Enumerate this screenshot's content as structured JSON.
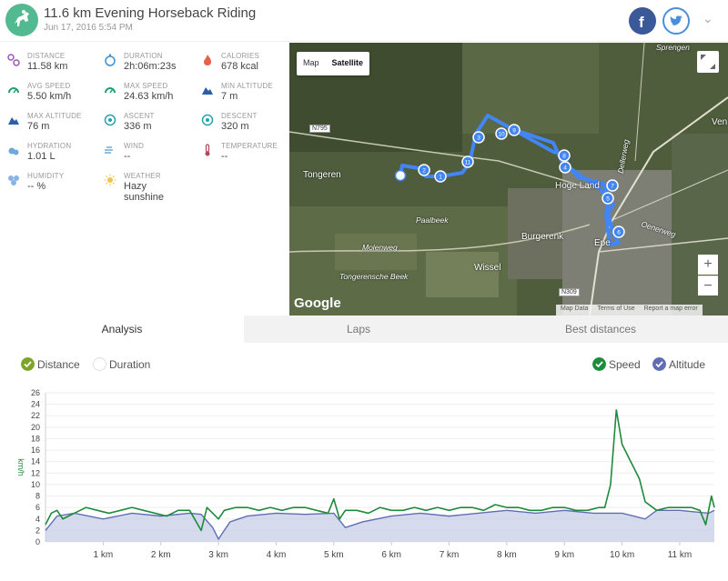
{
  "header": {
    "title": "11.6 km Evening Horseback Riding",
    "date": "Jun 17, 2016 5:54 PM"
  },
  "stats": [
    {
      "label": "DISTANCE",
      "value": "11.58 km",
      "icon": "distance-icon",
      "color": "#9b59b6"
    },
    {
      "label": "DURATION",
      "value": "2h:06m:23s",
      "icon": "stopwatch-icon",
      "color": "#3b8fd6"
    },
    {
      "label": "CALORIES",
      "value": "678 kcal",
      "icon": "flame-icon",
      "color": "#e8604c"
    },
    {
      "label": "AVG SPEED",
      "value": "5.50 km/h",
      "icon": "speedometer-icon",
      "color": "#21a07a"
    },
    {
      "label": "MAX SPEED",
      "value": "24.63 km/h",
      "icon": "speedometer-icon",
      "color": "#21a07a"
    },
    {
      "label": "MIN ALTITUDE",
      "value": "7 m",
      "icon": "mountain-icon",
      "color": "#2c5fa8"
    },
    {
      "label": "MAX ALTITUDE",
      "value": "76 m",
      "icon": "mountain-icon",
      "color": "#2c5fa8"
    },
    {
      "label": "ASCENT",
      "value": "336 m",
      "icon": "ascent-icon",
      "color": "#28a0b0"
    },
    {
      "label": "DESCENT",
      "value": "320 m",
      "icon": "descent-icon",
      "color": "#28a0b0"
    },
    {
      "label": "HYDRATION",
      "value": "1.01 L",
      "icon": "water-drops-icon",
      "color": "#6fa8dc"
    },
    {
      "label": "WIND",
      "value": "--",
      "icon": "wind-icon",
      "color": "#6fa8dc"
    },
    {
      "label": "TEMPERATURE",
      "value": "--",
      "icon": "thermometer-icon",
      "color": "#b5455b"
    },
    {
      "label": "HUMIDITY",
      "value": "-- %",
      "icon": "humidity-icon",
      "color": "#8ab4e8"
    },
    {
      "label": "WEATHER",
      "value": "Hazy sunshine",
      "icon": "weather-sun-icon",
      "color": "#f2c14e"
    }
  ],
  "map": {
    "type_map": "Map",
    "type_satellite": "Satellite",
    "zoom_in": "+",
    "zoom_out": "−",
    "logo": "Google",
    "footer": [
      "Map Data",
      "Terms of Use",
      "Report a map error"
    ],
    "labels": [
      {
        "text": "Tongeren",
        "style": ""
      },
      {
        "text": "Paalbeek",
        "style": "it"
      },
      {
        "text": "Molenweg",
        "style": "it"
      },
      {
        "text": "Wissel",
        "style": ""
      },
      {
        "text": "Burgerenk",
        "style": ""
      },
      {
        "text": "Hoge Land",
        "style": ""
      },
      {
        "text": "Epe",
        "style": ""
      },
      {
        "text": "Tongerensche Beek",
        "style": "it"
      },
      {
        "text": "Oenerweg",
        "style": "it"
      },
      {
        "text": "Dellerweg",
        "style": "it"
      },
      {
        "text": "Sprengen",
        "style": "it"
      },
      {
        "text": "Ven",
        "style": ""
      }
    ],
    "road_badges": [
      "N795",
      "N309"
    ],
    "route_color": "#4285f4",
    "markers": [
      "1",
      "2",
      "3",
      "4",
      "5",
      "6",
      "7",
      "8",
      "9",
      "10",
      "11"
    ]
  },
  "tabs": {
    "analysis": "Analysis",
    "laps": "Laps",
    "best": "Best distances"
  },
  "toggles": {
    "distance": "Distance",
    "duration": "Duration",
    "speed": "Speed",
    "altitude": "Altitude"
  },
  "chart_data": {
    "type": "line",
    "ylabel": "km/h",
    "ylim": [
      0,
      26
    ],
    "yticks": [
      0,
      2,
      4,
      6,
      8,
      10,
      12,
      14,
      16,
      18,
      20,
      22,
      24,
      26
    ],
    "xlabel": "",
    "xlim": [
      0,
      11.6
    ],
    "xticks": [
      "1 km",
      "2 km",
      "3 km",
      "4 km",
      "5 km",
      "6 km",
      "7 km",
      "8 km",
      "9 km",
      "10 km",
      "11 km"
    ],
    "grid": true,
    "legend": "top-right",
    "series": [
      {
        "name": "Speed",
        "color": "#1e8a3c",
        "x": [
          0,
          0.1,
          0.2,
          0.3,
          0.5,
          0.7,
          0.9,
          1.1,
          1.3,
          1.5,
          1.7,
          1.9,
          2.1,
          2.3,
          2.5,
          2.7,
          2.8,
          2.9,
          3.0,
          3.1,
          3.3,
          3.5,
          3.7,
          3.9,
          4.1,
          4.3,
          4.5,
          4.7,
          4.9,
          5.0,
          5.1,
          5.2,
          5.4,
          5.6,
          5.8,
          6.0,
          6.2,
          6.4,
          6.6,
          6.8,
          7.0,
          7.2,
          7.4,
          7.6,
          7.8,
          8.0,
          8.2,
          8.4,
          8.6,
          8.8,
          9.0,
          9.2,
          9.4,
          9.6,
          9.7,
          9.8,
          9.9,
          10.0,
          10.1,
          10.2,
          10.3,
          10.4,
          10.6,
          10.8,
          11.0,
          11.2,
          11.35,
          11.45,
          11.55,
          11.6
        ],
        "values": [
          3,
          5,
          5.5,
          4,
          5,
          6,
          5.5,
          5,
          5.5,
          6,
          5.5,
          5,
          4.5,
          5.5,
          5.5,
          2,
          6,
          5,
          4,
          5.5,
          6,
          6,
          5.5,
          6,
          5.5,
          6,
          6,
          5.5,
          5,
          7.5,
          4,
          5.5,
          5.5,
          5,
          6,
          5.5,
          5.5,
          6,
          5.5,
          6,
          5.5,
          6,
          6,
          5.5,
          6.5,
          6,
          6,
          5.5,
          5.5,
          6,
          6,
          5.5,
          5.5,
          6,
          6,
          10,
          23,
          17,
          15,
          13,
          11,
          7,
          5.5,
          6,
          6,
          6,
          5.5,
          3,
          8,
          6
        ]
      },
      {
        "name": "Altitude",
        "color": "#5f6db3",
        "x": [
          0,
          0.2,
          0.5,
          1.0,
          1.5,
          2.0,
          2.5,
          2.7,
          2.9,
          3.0,
          3.2,
          3.5,
          4.0,
          4.5,
          5.0,
          5.2,
          5.5,
          6.0,
          6.5,
          7.0,
          7.5,
          8.0,
          8.5,
          9.0,
          9.5,
          10.0,
          10.2,
          10.4,
          10.6,
          11.0,
          11.5,
          11.6
        ],
        "values": [
          2,
          4.5,
          5,
          4,
          5,
          4.5,
          5,
          4.8,
          2.5,
          0.5,
          3.5,
          4.5,
          5,
          4.8,
          5,
          2.5,
          3.5,
          4.5,
          5,
          4.5,
          5,
          5.5,
          5,
          5.5,
          5,
          5,
          4.5,
          4,
          5.5,
          5.5,
          5,
          5.5
        ]
      }
    ]
  }
}
